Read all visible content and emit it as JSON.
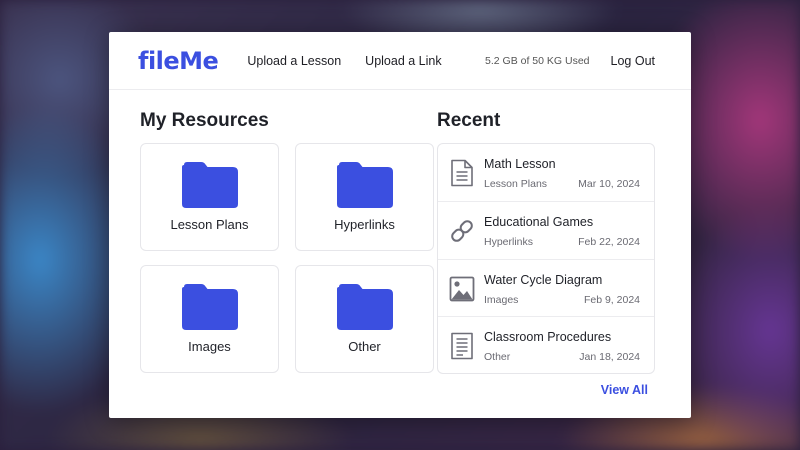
{
  "colors": {
    "brand": "#3b4fe0",
    "folder": "#3b4fe0",
    "icon_gray": "#6e6e78"
  },
  "header": {
    "logo": "fileMe",
    "nav": [
      {
        "label": "Upload a Lesson"
      },
      {
        "label": "Upload a Link"
      }
    ],
    "storage": "5.2 GB of 50 KG Used",
    "logout_label": "Log Out"
  },
  "resources": {
    "title": "My Resources",
    "folders": [
      {
        "label": "Lesson Plans",
        "icon": "folder-icon"
      },
      {
        "label": "Hyperlinks",
        "icon": "folder-icon"
      },
      {
        "label": "Images",
        "icon": "folder-icon"
      },
      {
        "label": "Other",
        "icon": "folder-icon"
      }
    ]
  },
  "recent": {
    "title": "Recent",
    "items": [
      {
        "title": "Math Lesson",
        "category": "Lesson Plans",
        "date": "Mar 10, 2024",
        "icon": "document-icon"
      },
      {
        "title": "Educational Games",
        "category": "Hyperlinks",
        "date": "Feb 22, 2024",
        "icon": "link-icon"
      },
      {
        "title": "Water Cycle Diagram",
        "category": "Images",
        "date": "Feb 9, 2024",
        "icon": "image-icon"
      },
      {
        "title": "Classroom Procedures",
        "category": "Other",
        "date": "Jan 18, 2024",
        "icon": "document-icon"
      }
    ],
    "view_all_label": "View All"
  }
}
